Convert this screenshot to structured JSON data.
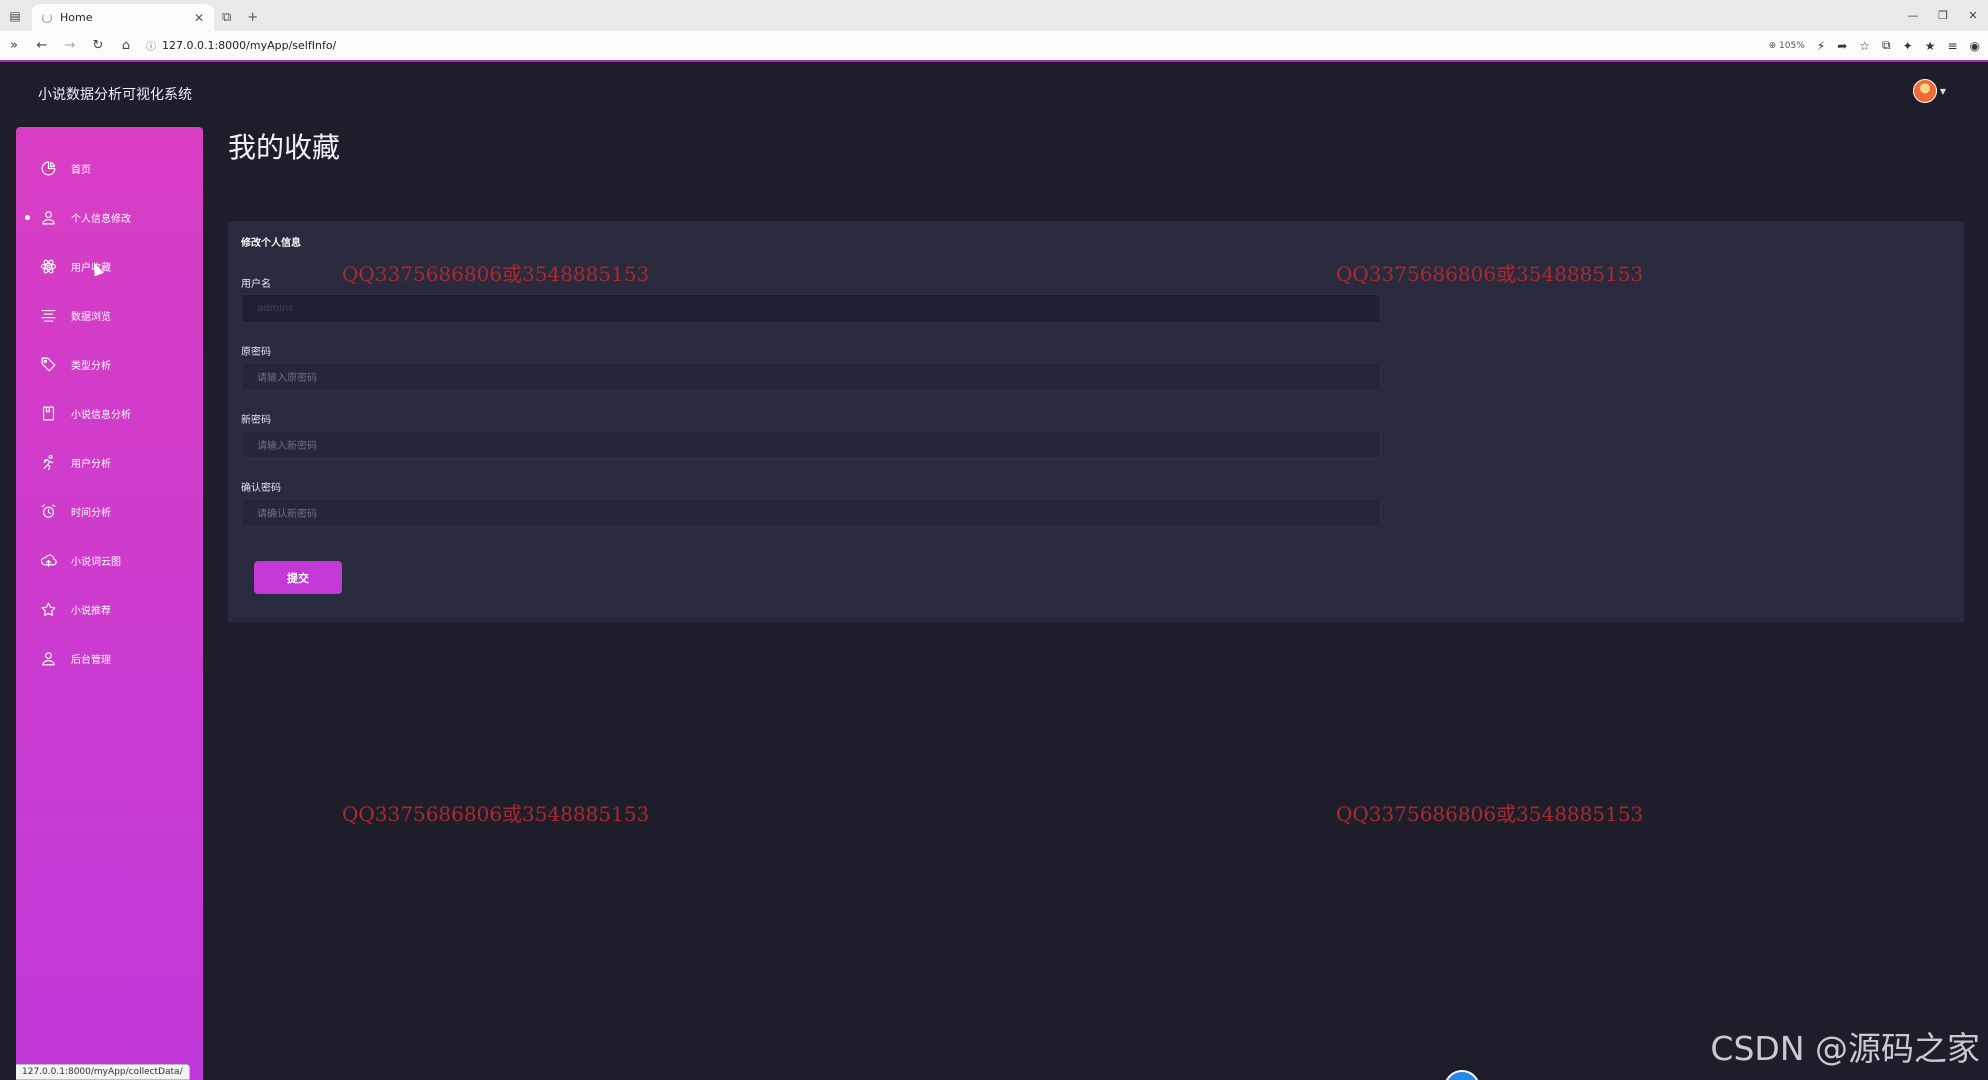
{
  "browser": {
    "tab_title": "Home",
    "url": "127.0.0.1:8000/myApp/selfInfo/",
    "zoom": "105%",
    "status_url": "127.0.0.1:8000/myApp/collectData/"
  },
  "app": {
    "title": "小说数据分析可视化系统"
  },
  "sidebar": {
    "items": [
      {
        "label": "首页",
        "icon": "pie-chart-icon"
      },
      {
        "label": "个人信息修改",
        "icon": "user-icon",
        "active": true
      },
      {
        "label": "用户收藏",
        "icon": "atom-icon"
      },
      {
        "label": "数据浏览",
        "icon": "align-center-icon"
      },
      {
        "label": "类型分析",
        "icon": "tag-icon"
      },
      {
        "label": "小说信息分析",
        "icon": "book-icon"
      },
      {
        "label": "用户分析",
        "icon": "running-icon"
      },
      {
        "label": "时间分析",
        "icon": "alarm-clock-icon"
      },
      {
        "label": "小说词云图",
        "icon": "cloud-upload-icon"
      },
      {
        "label": "小说推荐",
        "icon": "star-icon"
      },
      {
        "label": "后台管理",
        "icon": "user-admin-icon"
      }
    ]
  },
  "main": {
    "page_title": "我的收藏",
    "card_title": "修改个人信息",
    "fields": [
      {
        "label": "用户名",
        "value": "admins",
        "placeholder": "",
        "disabled": true
      },
      {
        "label": "原密码",
        "value": "",
        "placeholder": "请输入原密码",
        "disabled": false
      },
      {
        "label": "新密码",
        "value": "",
        "placeholder": "请输入新密码",
        "disabled": false
      },
      {
        "label": "确认密码",
        "value": "",
        "placeholder": "请确认新密码",
        "disabled": false
      }
    ],
    "submit_label": "提交"
  },
  "watermark": "QQ3375686806或3548885153",
  "csdn_watermark": "CSDN @源码之家",
  "colors": {
    "accent": "#c239d6",
    "sidebar_top": "#d93ec4",
    "sidebar_bottom": "#c038d8",
    "background": "#1e1e2a",
    "card": "#292a3d",
    "watermark": "#a82a2e"
  }
}
